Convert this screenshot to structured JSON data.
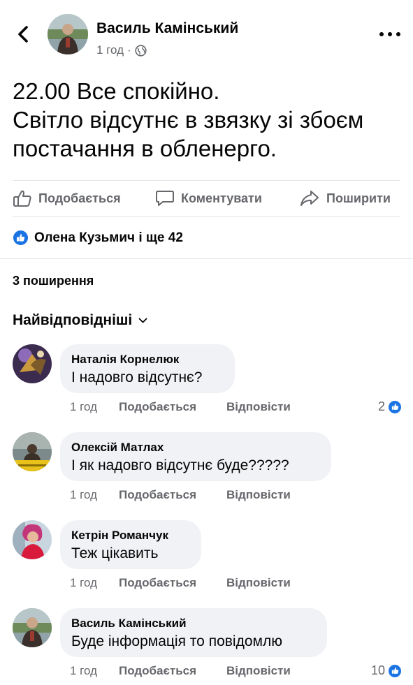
{
  "post": {
    "author": "Василь Камінський",
    "time": "1 год",
    "meta_separator": "·",
    "privacy_icon": "globe-icon",
    "text": "22.00 Все спокійно.\nСвітло відсутнє в звязку зі збоєм постачання в обленерго."
  },
  "actions": {
    "like": "Подобається",
    "comment": "Коментувати",
    "share": "Поширити"
  },
  "reactions": {
    "icon": "like-icon",
    "summary": "Олена Кузьмич і ще 42"
  },
  "shares": "3 поширення",
  "sort_label": "Найвідповідніші",
  "colors": {
    "accent": "#1b74e4",
    "secondary_text": "#65676b",
    "bubble": "#f0f2f5"
  },
  "comments": [
    {
      "name": "Наталія Корнелюк",
      "text": "І надовго відсутнє?",
      "time": "1 год",
      "like": "Подобається",
      "reply": "Відповісти",
      "reactions": "2"
    },
    {
      "name": "Олексій Матлах",
      "text": "І як надовго відсутнє буде?????",
      "time": "1 год",
      "like": "Подобається",
      "reply": "Відповісти",
      "reactions": ""
    },
    {
      "name": "Кетрін Романчук",
      "text": "Теж цікавить",
      "time": "1 год",
      "like": "Подобається",
      "reply": "Відповісти",
      "reactions": ""
    },
    {
      "name": "Василь Камінський",
      "text": "Буде інформація то повідомлю",
      "time": "1 год",
      "like": "Подобається",
      "reply": "Відповісти",
      "reactions": "10"
    }
  ]
}
